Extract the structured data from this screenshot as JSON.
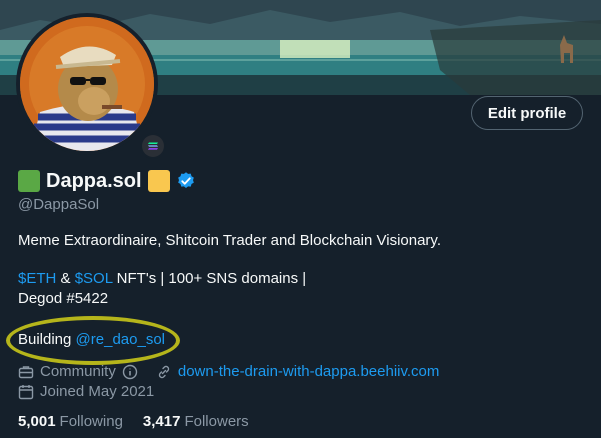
{
  "profile": {
    "display_name": "Dappa.sol",
    "handle": "@DappaSol",
    "edit_button": "Edit profile",
    "verified": true,
    "colors": {
      "accent": "#1d9bf0",
      "left_square": "#5aa845",
      "right_square": "#f9c74f",
      "highlight": "#b5b51b"
    }
  },
  "bio": {
    "line1": "Meme Extraordinaire, Shitcoin Trader and Blockchain Visionary.",
    "eth_tag": "$ETH",
    "amp": " & ",
    "sol_tag": "$SOL",
    "line2_rest": " NFT's | 100+ SNS domains |",
    "line3": "Degod #5422",
    "building_prefix": "Building ",
    "building_link": "@re_dao_sol"
  },
  "meta": {
    "category": "Community",
    "website": "down-the-drain-with-dappa.beehiiv.com",
    "joined": "Joined May 2021"
  },
  "stats": {
    "following_count": "5,001",
    "following_label": "Following",
    "followers_count": "3,417",
    "followers_label": "Followers"
  }
}
